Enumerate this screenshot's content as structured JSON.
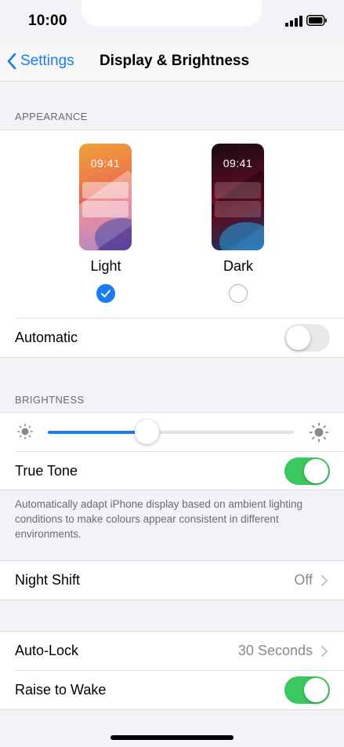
{
  "status_bar": {
    "time": "10:00"
  },
  "nav": {
    "back_label": "Settings",
    "title": "Display & Brightness"
  },
  "appearance": {
    "header": "APPEARANCE",
    "light": {
      "label": "Light",
      "preview_time": "09:41",
      "selected": true
    },
    "dark": {
      "label": "Dark",
      "preview_time": "09:41",
      "selected": false
    },
    "automatic_label": "Automatic",
    "automatic_on": false
  },
  "brightness": {
    "header": "BRIGHTNESS",
    "level": 0.4,
    "true_tone_label": "True Tone",
    "true_tone_on": true,
    "footnote": "Automatically adapt iPhone display based on ambient lighting conditions to make colours appear consistent in different environments."
  },
  "night_shift": {
    "label": "Night Shift",
    "value": "Off"
  },
  "auto_lock": {
    "label": "Auto-Lock",
    "value": "30 Seconds"
  },
  "raise_to_wake": {
    "label": "Raise to Wake",
    "on": true
  },
  "colors": {
    "accent": "#1a7cf3",
    "toggle_on": "#3cc860",
    "background": "#f2f2f7"
  }
}
